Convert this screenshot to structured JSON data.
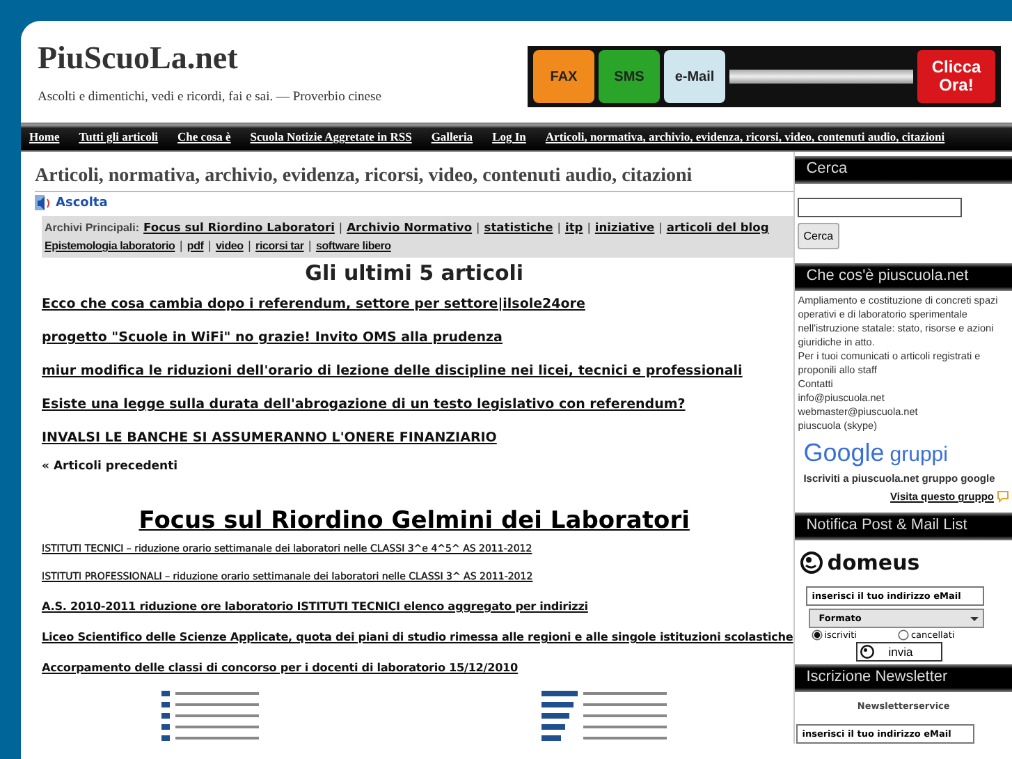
{
  "site": {
    "title": "PiuScuoLa.net",
    "tagline": "Ascolti e dimentichi, vedi e ricordi, fai e sai. — Proverbio cinese"
  },
  "banner": {
    "items": [
      "FAX",
      "SMS",
      "e-Mail"
    ],
    "cta": "Clicca Ora!"
  },
  "nav": [
    "Home",
    "Tutti gli articoli",
    "Che cosa è",
    "Scuola Notizie Aggretate in RSS",
    "Galleria",
    "Log In",
    "Articoli, normativa, archivio, evidenza, ricorsi, video, contenuti audio, citazioni"
  ],
  "page_title": "Articoli, normativa, archivio, evidenza, ricorsi, video, contenuti audio, citazioni",
  "listen": "Ascolta",
  "archives": {
    "label": "Archivi Principali:",
    "separator": "|",
    "lines": [
      [
        "Focus sul Riordino Laboratori",
        "Archivio Normativo",
        "statistiche",
        "itp",
        "iniziative",
        "articoli del blog"
      ],
      [
        "Epistemologia laboratorio",
        "pdf",
        "video",
        "ricorsi tar",
        "software libero"
      ]
    ]
  },
  "latest": {
    "heading": "Gli ultimi 5 articoli",
    "articles": [
      "Ecco che cosa cambia dopo i referendum, settore per settore|ilsole24ore",
      "progetto \"Scuole in WiFi\" no grazie! Invito OMS alla prudenza",
      "miur modifica le riduzioni dell'orario di lezione delle discipline nei licei, tecnici e professionali",
      "Esiste una legge sulla durata dell'abrogazione di un testo legislativo con referendum?",
      "INVALSI LE BANCHE SI ASSUMERANNO L'ONERE FINANZIARIO"
    ],
    "older": "« Articoli precedenti"
  },
  "focus": {
    "heading": "Focus sul Riordino Gelmini dei Laboratori",
    "links": [
      {
        "text": "ISTITUTI TECNICI – riduzione orario settimanale dei laboratori nelle CLASSI 3^e 4^5^ AS 2011-2012",
        "kind": "plain"
      },
      {
        "text": "ISTITUTI PROFESSIONALI – riduzione orario settimanale dei laboratori nelle CLASSI 3^ AS 2011-2012",
        "kind": "plain"
      },
      {
        "text": "A.S. 2010-2011 riduzione ore laboratorio ISTITUTI TECNICI elenco aggregato per indirizzi",
        "kind": "bold"
      },
      {
        "text": "Liceo Scientifico delle Scienze Applicate, quota dei piani di studio rimessa alle regioni e alle singole istituzioni scolastiche",
        "kind": "bold"
      },
      {
        "text": "Accorpamento delle classi di concorso per i docenti di laboratorio 15/12/2010",
        "kind": "bold"
      }
    ]
  },
  "sidebar": {
    "search": {
      "title": "Cerca",
      "button": "Cerca"
    },
    "about": {
      "title": "Che cos'è piuscuola.net",
      "lines": [
        "Ampliamento e costituzione di concreti spazi operativi e di laboratorio sperimentale nell'istruzione statale: stato, risorse e azioni giuridiche in atto.",
        "Per i tuoi comunicati o articoli registrati e proponili allo staff",
        "Contatti",
        "info@piuscuola.net",
        "webmaster@piuscuola.net",
        "piuscuola (skype)"
      ]
    },
    "group": {
      "logo": "Google",
      "logo_suffix": "gruppi",
      "text": "Iscriviti a piuscuola.net gruppo google",
      "link": "Visita questo gruppo"
    },
    "notify": {
      "title": "Notifica Post & Mail List",
      "logo": "domeus",
      "email": "inserisci il tuo indirizzo eMail",
      "format": "Formato",
      "options": [
        {
          "label": "iscriviti",
          "selected": true
        },
        {
          "label": "cancellati",
          "selected": false
        }
      ],
      "button": "invia"
    },
    "newsletter": {
      "title": "Iscrizione Newsletter",
      "service": "Newsletterservice",
      "email": "inserisci il tuo indirizzo eMail"
    }
  }
}
